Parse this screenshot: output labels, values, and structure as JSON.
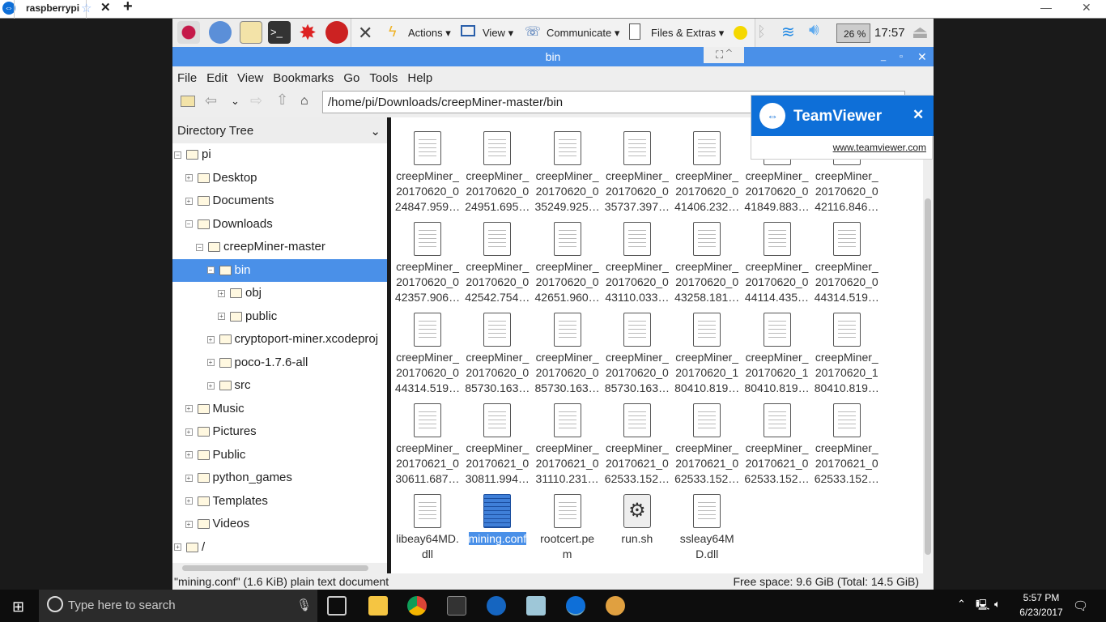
{
  "browser": {
    "tab_title": "raspberrypi",
    "add": "+",
    "close": "✕",
    "star": "☆",
    "logo": "⇔",
    "min": "—",
    "max": "❐",
    "winclose": "✕"
  },
  "panel": {
    "clock": "17:57",
    "cpu": "26 %",
    "close_x": "✕"
  },
  "teamviewer_menu": {
    "items": [
      "Actions",
      "View",
      "Communicate",
      "Files & Extras"
    ]
  },
  "window": {
    "title": "bin",
    "controls": [
      "_",
      "▫",
      "✕"
    ]
  },
  "menu": [
    "File",
    "Edit",
    "View",
    "Bookmarks",
    "Go",
    "Tools",
    "Help"
  ],
  "toolbar": {
    "path": "/home/pi/Downloads/creepMiner-master/bin"
  },
  "sidebar": {
    "header": "Directory Tree",
    "items": [
      {
        "label": "pi",
        "level": 0,
        "exp": "−"
      },
      {
        "label": "Desktop",
        "level": 1,
        "exp": "+"
      },
      {
        "label": "Documents",
        "level": 1,
        "exp": "+"
      },
      {
        "label": "Downloads",
        "level": 1,
        "exp": "−"
      },
      {
        "label": "creepMiner-master",
        "level": 2,
        "exp": "−"
      },
      {
        "label": "bin",
        "level": 3,
        "exp": "−",
        "selected": true
      },
      {
        "label": "obj",
        "level": 4,
        "exp": "+"
      },
      {
        "label": "public",
        "level": 4,
        "exp": "+"
      },
      {
        "label": "cryptoport-miner.xcodeproj",
        "level": 3,
        "exp": "+"
      },
      {
        "label": "poco-1.7.6-all",
        "level": 3,
        "exp": "+"
      },
      {
        "label": "src",
        "level": 3,
        "exp": "+"
      },
      {
        "label": "Music",
        "level": 1,
        "exp": "+"
      },
      {
        "label": "Pictures",
        "level": 1,
        "exp": "+"
      },
      {
        "label": "Public",
        "level": 1,
        "exp": "+"
      },
      {
        "label": "python_games",
        "level": 1,
        "exp": "+"
      },
      {
        "label": "Templates",
        "level": 1,
        "exp": "+"
      },
      {
        "label": "Videos",
        "level": 1,
        "exp": "+"
      },
      {
        "label": "/",
        "level": 0,
        "exp": "+"
      }
    ]
  },
  "files": [
    [
      "creepMiner_",
      "20170620_0",
      "24847.959…"
    ],
    [
      "creepMiner_",
      "20170620_0",
      "24951.695…"
    ],
    [
      "creepMiner_",
      "20170620_0",
      "35249.925…"
    ],
    [
      "creepMiner_",
      "20170620_0",
      "35737.397…"
    ],
    [
      "creepMiner_",
      "20170620_0",
      "41406.232…"
    ],
    [
      "creepMiner_",
      "20170620_0",
      "41849.883…"
    ],
    [
      "creepMiner_",
      "20170620_0",
      "42116.846…"
    ],
    [
      "creepMiner_",
      "20170620_0",
      "42357.906…"
    ],
    [
      "creepMiner_",
      "20170620_0",
      "42542.754…"
    ],
    [
      "creepMiner_",
      "20170620_0",
      "42651.960…"
    ],
    [
      "creepMiner_",
      "20170620_0",
      "43110.033…"
    ],
    [
      "creepMiner_",
      "20170620_0",
      "43258.181…"
    ],
    [
      "creepMiner_",
      "20170620_0",
      "44114.435…"
    ],
    [
      "creepMiner_",
      "20170620_0",
      "44314.519…"
    ],
    [
      "creepMiner_",
      "20170620_0",
      "44314.519…"
    ],
    [
      "creepMiner_",
      "20170620_0",
      "85730.163…"
    ],
    [
      "creepMiner_",
      "20170620_0",
      "85730.163…"
    ],
    [
      "creepMiner_",
      "20170620_0",
      "85730.163…"
    ],
    [
      "creepMiner_",
      "20170620_1",
      "80410.819…"
    ],
    [
      "creepMiner_",
      "20170620_1",
      "80410.819…"
    ],
    [
      "creepMiner_",
      "20170620_1",
      "80410.819…"
    ],
    [
      "creepMiner_",
      "20170621_0",
      "30611.687…"
    ],
    [
      "creepMiner_",
      "20170621_0",
      "30811.994…"
    ],
    [
      "creepMiner_",
      "20170621_0",
      "31110.231…"
    ],
    [
      "creepMiner_",
      "20170621_0",
      "62533.152…"
    ],
    [
      "creepMiner_",
      "20170621_0",
      "62533.152…"
    ],
    [
      "creepMiner_",
      "20170621_0",
      "62533.152…"
    ],
    [
      "creepMiner_",
      "20170621_0",
      "62533.152…"
    ],
    [
      "libeay64MD.",
      "dll"
    ],
    [
      "mining.conf"
    ],
    [
      "rootcert.pe",
      "m"
    ],
    [
      "run.sh"
    ],
    [
      "ssleay64M",
      "D.dll"
    ]
  ],
  "selected_file": "mining.conf",
  "script_file": "run.sh",
  "status": {
    "left": "\"mining.conf\" (1.6 KiB) plain text document",
    "right": "Free space: 9.6 GiB (Total: 14.5 GiB)"
  },
  "teamviewer_popup": {
    "brand": "TeamViewer",
    "link": "www.teamviewer.com",
    "close": "✕"
  },
  "taskbar": {
    "search_placeholder": "Type here to search",
    "time": "5:57 PM",
    "date": "6/23/2017"
  },
  "colors": {
    "accent": "#4a90e8",
    "teamviewer": "#0e6fd8"
  }
}
